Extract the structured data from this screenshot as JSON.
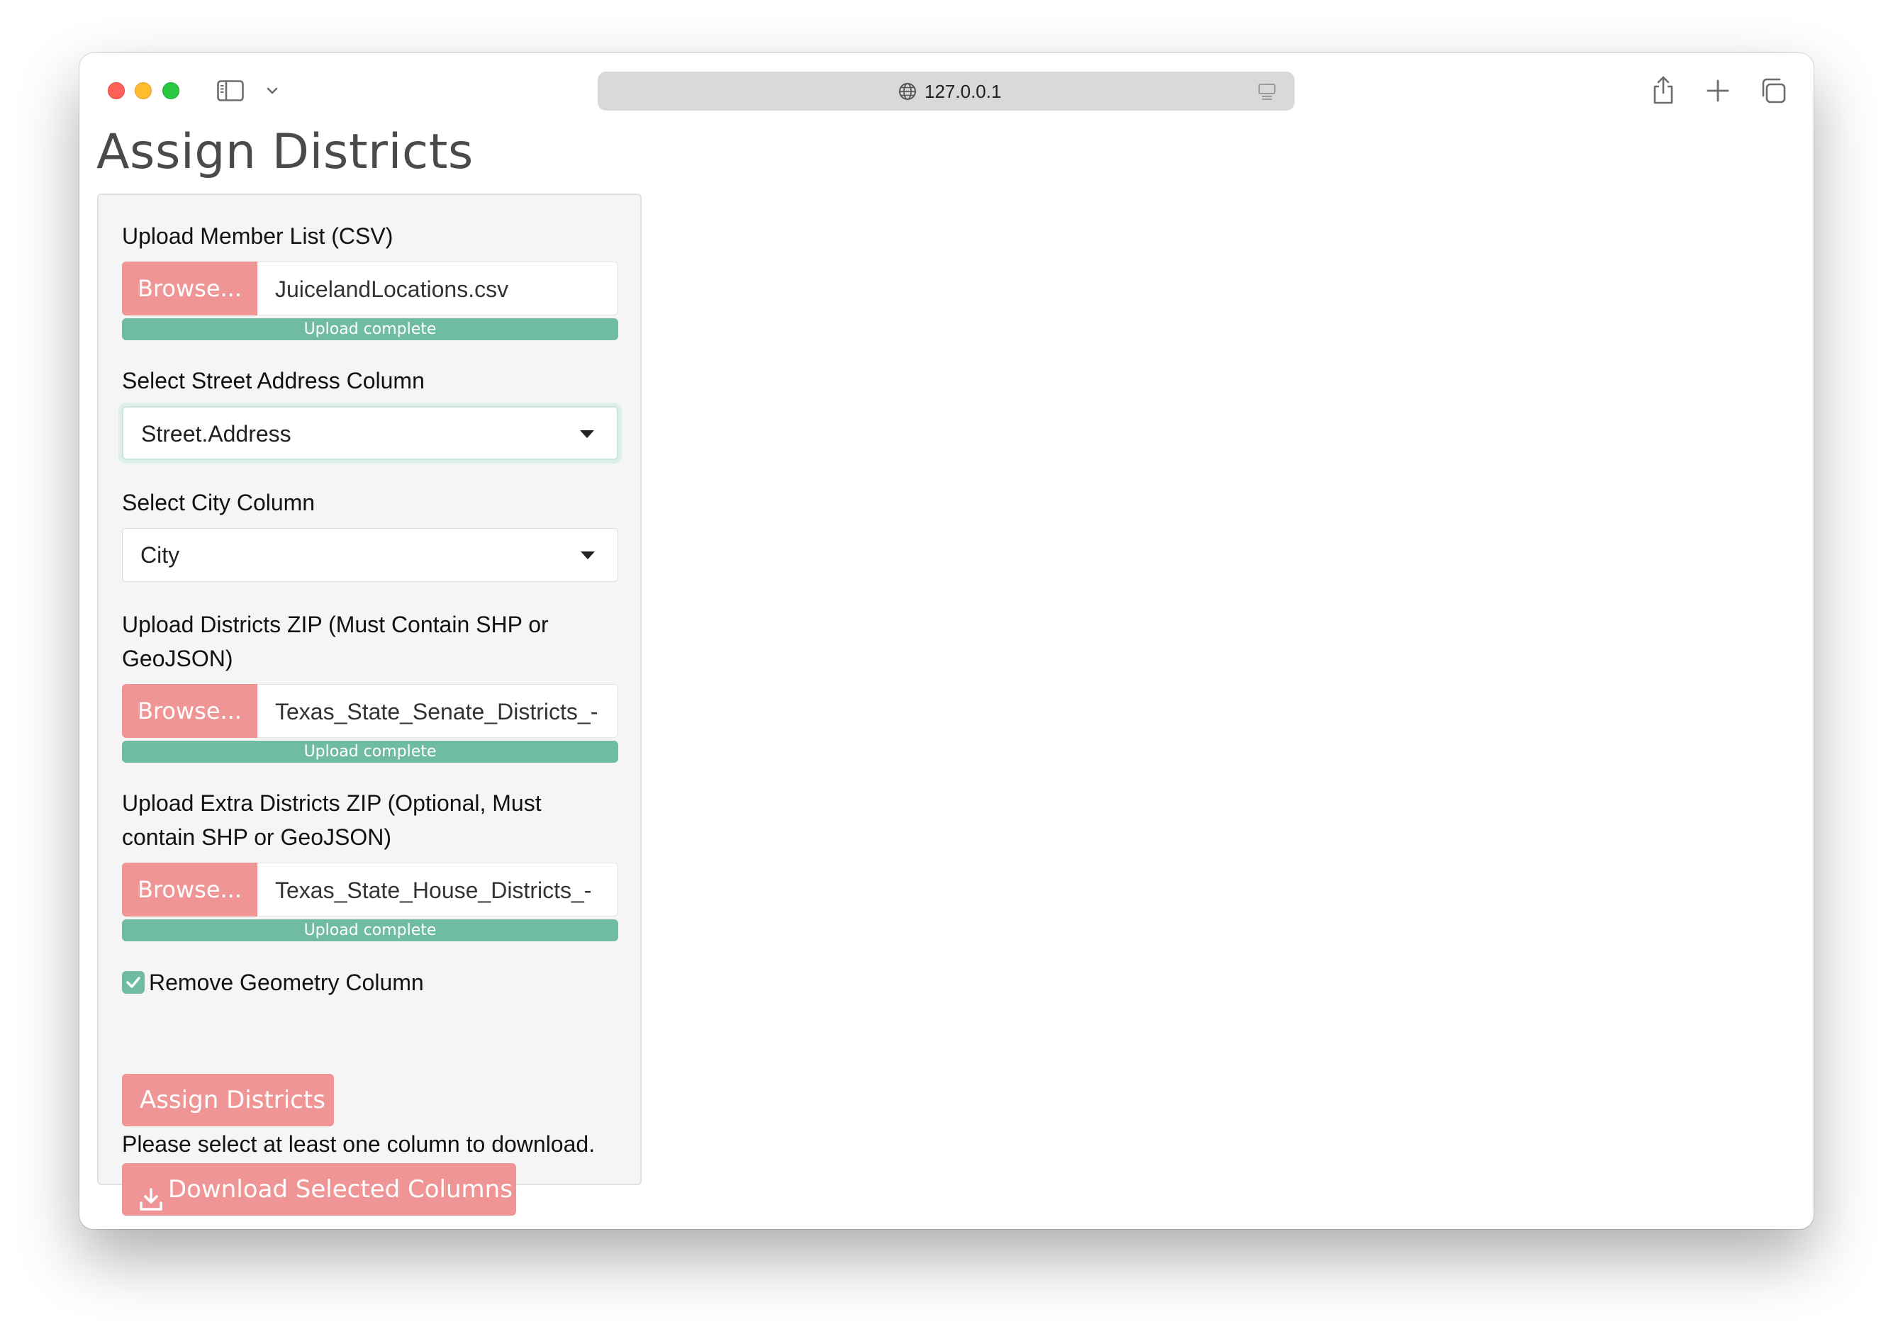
{
  "browser": {
    "url": "127.0.0.1"
  },
  "page": {
    "title": "Assign Districts"
  },
  "form": {
    "member_upload": {
      "label": "Upload Member List (CSV)",
      "browse_label": "Browse...",
      "file_name": "JuicelandLocations.csv",
      "progress_text": "Upload complete",
      "progress": 1.0
    },
    "street_select": {
      "label": "Select Street Address Column",
      "value": "Street.Address"
    },
    "city_select": {
      "label": "Select City Column",
      "value": "City"
    },
    "districts_upload": {
      "label_line1": "Upload Districts ZIP (Must Contain SHP or",
      "label_line2": "GeoJSON)",
      "browse_label": "Browse...",
      "file_name": "Texas_State_Senate_Districts_-",
      "progress_text": "Upload complete",
      "progress": 1.0
    },
    "extra_upload": {
      "label_line1": "Upload Extra Districts ZIP (Optional, Must",
      "label_line2": "contain SHP or GeoJSON)",
      "browse_label": "Browse...",
      "file_name": "Texas_State_House_Districts_-",
      "progress_text": "Upload complete",
      "progress": 1.0
    },
    "remove_geometry": {
      "label": "Remove Geometry Column",
      "checked": true
    },
    "assign_button": "Assign Districts",
    "hint": "Please select at least one column to download.",
    "download_button": "Download Selected Columns"
  },
  "colors": {
    "accent_button": "#f09595",
    "progress_green": "#70bca3"
  },
  "icons": [
    "sidebar-icon",
    "chevron-down-icon",
    "globe-icon",
    "reader-icon",
    "share-icon",
    "plus-icon",
    "tabs-icon",
    "caret-down-icon",
    "checkmark-icon",
    "download-icon"
  ]
}
